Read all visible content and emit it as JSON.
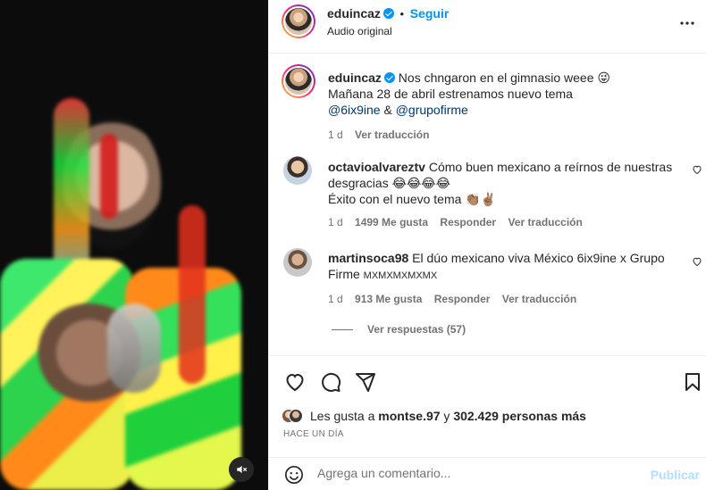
{
  "header": {
    "username": "eduincaz",
    "follow_label": "Seguir",
    "audio_label": "Audio original",
    "separator": "•"
  },
  "caption": {
    "username": "eduincaz",
    "line1": "Nos chngaron en el gimnasio weee 😜",
    "line2": "Mañana 28 de abril estrenamos nuevo tema",
    "mention1": "@6ix9ine",
    "amp": "&",
    "mention2": "@grupofirme",
    "time": "1 d",
    "translate": "Ver traducción"
  },
  "comments": [
    {
      "username": "octavioalvareztv",
      "text1": "Cómo buen mexicano a reírnos de nuestras",
      "text2": "desgracias 😂😂😂😂",
      "text3": "Éxito con el nuevo tema 👏🏽✌🏽",
      "time": "1 d",
      "likes": "1499 Me gusta",
      "reply": "Responder",
      "translate": "Ver traducción"
    },
    {
      "username": "martinsoca98",
      "text1": "El dúo mexicano viva México 6ix9ine x Grupo",
      "text2": "Firme",
      "text2_small": "MXMXMXMXMX",
      "time": "1 d",
      "likes": "913 Me gusta",
      "reply": "Responder",
      "translate": "Ver traducción",
      "view_replies": "Ver respuestas (57)"
    }
  ],
  "likes": {
    "prefix": "Les gusta a",
    "user": "montse.97",
    "middle": "y",
    "count": "302.429 personas más"
  },
  "time_ago": "HACE UN DÍA",
  "composer": {
    "placeholder": "Agrega un comentario...",
    "publish_label": "Publicar"
  },
  "colors": {
    "accent": "#0095f6",
    "mention": "#00376b",
    "muted": "#737373",
    "publish_disabled": "#b2dffc"
  }
}
